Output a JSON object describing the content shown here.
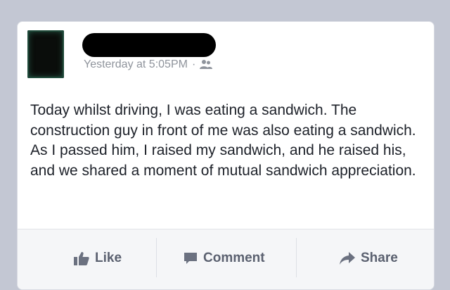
{
  "post": {
    "timestamp": "Yesterday at 5:05PM",
    "separator": "·",
    "audience_icon": "friends-icon",
    "text": "Today whilst driving, I was eating a sandwich. The construction guy in front of me was also eating a sandwich. As I passed him, I raised my sandwich, and he raised his, and we shared a moment of mutual sandwich appreciation."
  },
  "actions": {
    "like_label": "Like",
    "comment_label": "Comment",
    "share_label": "Share"
  },
  "colors": {
    "background": "#c3c7d3",
    "card": "#ffffff",
    "action_text": "#5b6170",
    "meta_text": "#8f949c"
  }
}
